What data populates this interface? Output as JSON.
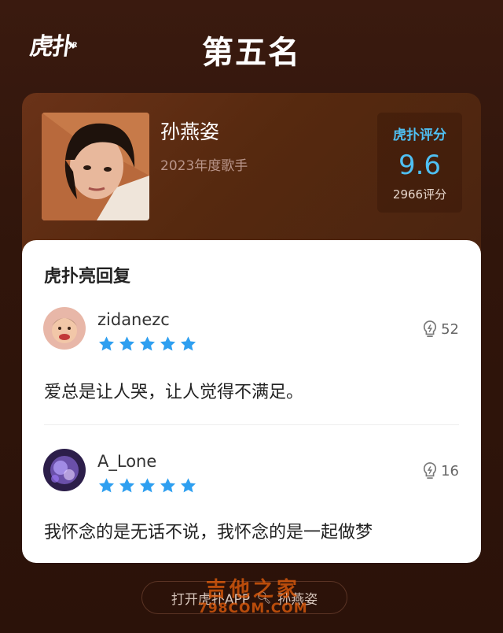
{
  "header": {
    "logo_text": "虎扑",
    "logo_small": "JR",
    "title": "第五名"
  },
  "singer": {
    "name": "孙燕姿",
    "subtitle": "2023年度歌手",
    "score_label": "虎扑评分",
    "score": "9.6",
    "score_count": "2966评分"
  },
  "comments_panel": {
    "title": "虎扑亮回复",
    "comments": [
      {
        "username": "zidanezc",
        "stars": 5,
        "likes": "52",
        "text": "爱总是让人哭，让人觉得不满足。"
      },
      {
        "username": "A_Lone",
        "stars": 5,
        "likes": "16",
        "text": "我怀念的是无话不说，我怀念的是一起做梦"
      }
    ]
  },
  "footer": {
    "open_app_label": "打开虎扑APP",
    "search_icon": "search-icon",
    "search_term": "孙燕姿"
  },
  "watermark": {
    "text": "吉他之家",
    "url": "798COM.COM"
  },
  "colors": {
    "background": "#2a1109",
    "accent_blue": "#4fc0f3",
    "star_blue": "#2e9ff0"
  }
}
